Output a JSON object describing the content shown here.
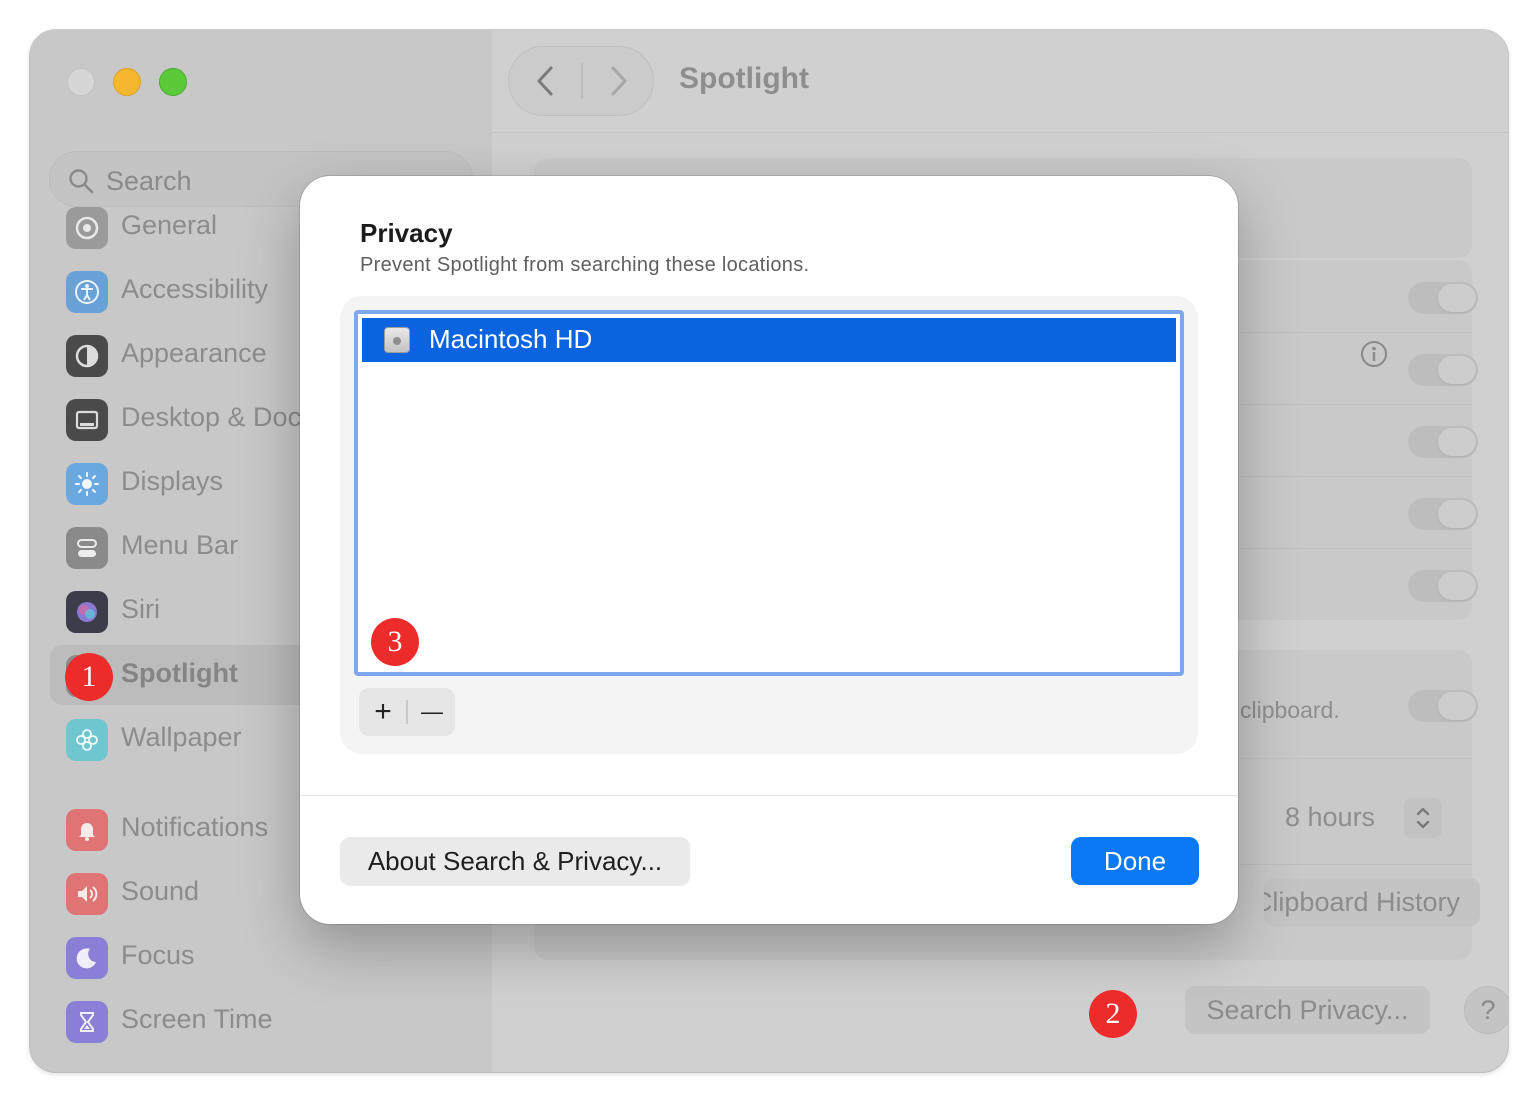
{
  "sidebar": {
    "search_placeholder": "Search",
    "items": [
      {
        "label": "General",
        "icon": "gear-icon",
        "color": "#9a9a9a"
      },
      {
        "label": "Accessibility",
        "icon": "accessibility-icon",
        "color": "#6aa0d8"
      },
      {
        "label": "Appearance",
        "icon": "appearance-icon",
        "color": "#4a4a4a"
      },
      {
        "label": "Desktop & Dock",
        "icon": "dock-icon",
        "color": "#4a4a4a"
      },
      {
        "label": "Displays",
        "icon": "sun-icon",
        "color": "#6aa8e0"
      },
      {
        "label": "Menu Bar",
        "icon": "menubar-icon",
        "color": "#8a8a8a"
      },
      {
        "label": "Siri",
        "icon": "siri-icon",
        "color": "#7e70c8"
      },
      {
        "label": "Spotlight",
        "icon": "spotlight-icon",
        "color": "#8a8a8a"
      },
      {
        "label": "Wallpaper",
        "icon": "wallpaper-icon",
        "color": "#6fc6cf"
      },
      {
        "label": "Notifications",
        "icon": "bell-icon",
        "color": "#e07474"
      },
      {
        "label": "Sound",
        "icon": "speaker-icon",
        "color": "#e07474"
      },
      {
        "label": "Focus",
        "icon": "moon-icon",
        "color": "#8a7fd6"
      },
      {
        "label": "Screen Time",
        "icon": "hourglass-icon",
        "color": "#8a7fd6"
      }
    ]
  },
  "main": {
    "title": "Spotlight",
    "clipboard_text": "clipboard.",
    "duration_value": "8 hours",
    "clipboard_history_button": "Clipboard History",
    "search_privacy_button": "Search Privacy...",
    "help_label": "?"
  },
  "dialog": {
    "title": "Privacy",
    "subtitle": "Prevent Spotlight from searching these locations.",
    "locations": [
      "Macintosh HD"
    ],
    "add_label": "+",
    "remove_label": "—",
    "about_button": "About Search & Privacy...",
    "done_button": "Done"
  },
  "annotations": [
    "1",
    "2",
    "3"
  ],
  "colors": {
    "accent": "#0b78f6",
    "selection": "#0a63df",
    "badge": "#ee2b2b"
  }
}
